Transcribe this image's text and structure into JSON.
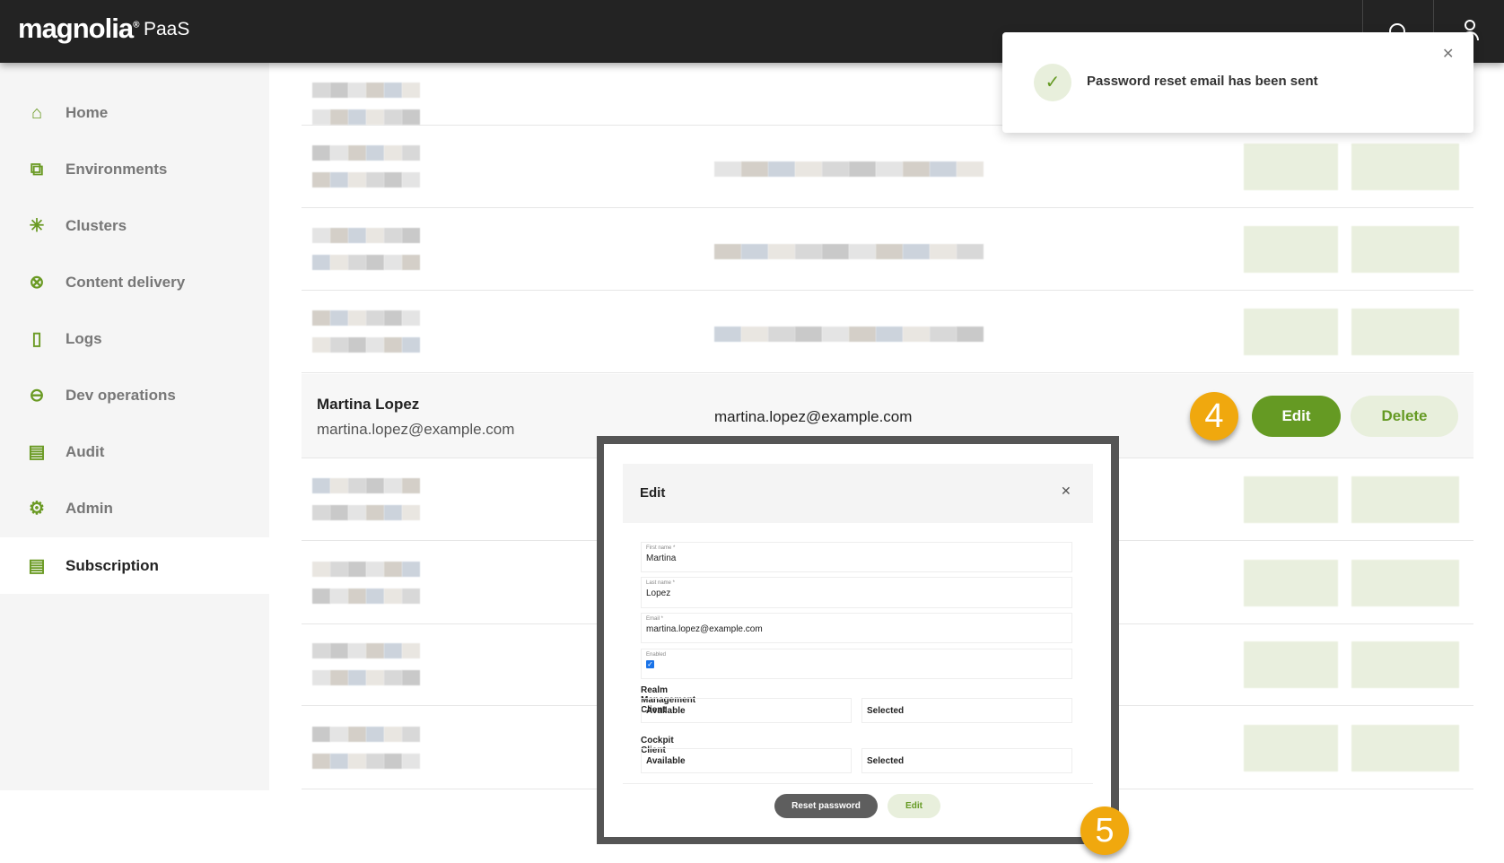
{
  "header": {
    "logo": "magnolia",
    "logo_mark": "®",
    "product": "PaaS"
  },
  "sidebar": {
    "items": [
      {
        "label": "Home",
        "icon": "home-icon"
      },
      {
        "label": "Environments",
        "icon": "environments-icon"
      },
      {
        "label": "Clusters",
        "icon": "clusters-icon"
      },
      {
        "label": "Content delivery",
        "icon": "content-delivery-icon"
      },
      {
        "label": "Logs",
        "icon": "logs-icon"
      },
      {
        "label": "Dev operations",
        "icon": "dev-operations-icon"
      },
      {
        "label": "Audit",
        "icon": "audit-icon"
      },
      {
        "label": "Admin",
        "icon": "gear-icon"
      },
      {
        "label": "Subscription",
        "icon": "subscription-icon",
        "active": true
      }
    ]
  },
  "toast": {
    "message": "Password reset email has been sent"
  },
  "user_row": {
    "name": "Martina Lopez",
    "email": "martina.lopez@example.com",
    "username": "martina.lopez@example.com",
    "edit": "Edit",
    "delete": "Delete"
  },
  "steps": {
    "step4": "4",
    "step5": "5"
  },
  "modal": {
    "title": "Edit",
    "fields": [
      {
        "label": "First name *",
        "value": "Martina"
      },
      {
        "label": "Last name *",
        "value": "Lopez"
      },
      {
        "label": "Email *",
        "value": "martina.lopez@example.com"
      }
    ],
    "enabled_label": "Enabled",
    "enabled": true,
    "realm_label": "Realm Management Client",
    "cockpit_label": "Cockpit Client",
    "available": "Available",
    "selected": "Selected",
    "reset": "Reset password",
    "edit": "Edit"
  },
  "colors": {
    "brand_green": "#659a23",
    "light_green": "#e8efdc",
    "badge": "#f0a80e",
    "header": "#232323"
  }
}
